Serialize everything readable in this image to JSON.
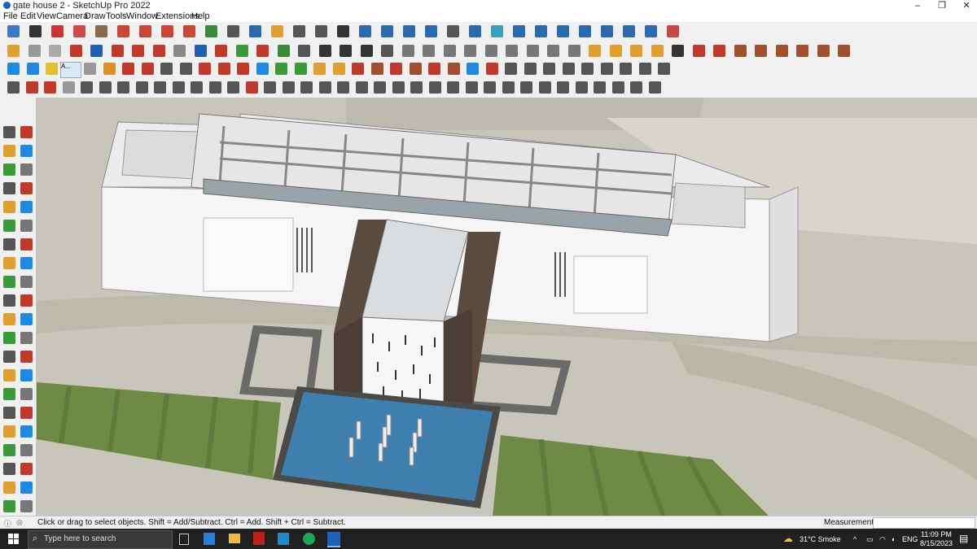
{
  "window": {
    "title": "gate house 2 - SketchUp Pro 2022",
    "minimize": "–",
    "maximize": "❐",
    "close": "✕"
  },
  "menu": [
    "File",
    "Edit",
    "View",
    "Camera",
    "Draw",
    "Tools",
    "Window",
    "Extensions",
    "Help"
  ],
  "toolbars": {
    "row1_colors": [
      "#3a78c9",
      "#333",
      "#c33",
      "#d04a4a",
      "#8a6a4a",
      "#c43",
      "#c43",
      "#c43",
      "#c43",
      "#3a8a3a",
      "#555",
      "#2a6ab0",
      "#e0a030",
      "#555",
      "#555",
      "#333",
      "#2a6ab0",
      "#2a6ab0",
      "#2a6ab0",
      "#2a6ab0",
      "#555",
      "#2a6ab0",
      "#3aa0c0",
      "#2a6ab0",
      "#2a6ab0",
      "#2a6ab0",
      "#2a6ab0",
      "#2a6ab0",
      "#2a6ab0",
      "#2a6ab0",
      "#c44"
    ],
    "row2_colors": [
      "#e0a030",
      "#999",
      "#aaa",
      "#c0392b",
      "#1e5fb0",
      "#c0392b",
      "#c0392b",
      "#c0392b",
      "#888",
      "#1e5fb0",
      "#c0392b",
      "#3a9a3a",
      "#c0392b",
      "#3a8a3a",
      "#555",
      "#333",
      "#333",
      "#333",
      "#555",
      "#777",
      "#777",
      "#777",
      "#777",
      "#777",
      "#777",
      "#777",
      "#777",
      "#777",
      "#e0a030",
      "#e0a030",
      "#e0a030",
      "#e0a030",
      "#333",
      "#c0392b",
      "#c0392b",
      "#a05030",
      "#a05030",
      "#a05030",
      "#a05030",
      "#a05030",
      "#a05030"
    ],
    "row3_colors": [
      "#1e88e5",
      "#1e88e5",
      "#e0c030",
      "#c04040",
      "#999",
      "#e09020",
      "#c0392b",
      "#c0392b",
      "#555",
      "#555",
      "#c0392b",
      "#c0392b",
      "#c0392b",
      "#1e88e5",
      "#3a9a3a",
      "#3a9a3a",
      "#e0a030",
      "#e0a030",
      "#c0392b",
      "#a05030",
      "#c0392b",
      "#a05030",
      "#c0392b",
      "#a05030",
      "#1e88e5",
      "#c0392b",
      "#555",
      "#555",
      "#555",
      "#555",
      "#555",
      "#555",
      "#555",
      "#555",
      "#555"
    ],
    "row4_colors": [
      "#555",
      "#c0392b",
      "#c0392b",
      "#999",
      "#555",
      "#555",
      "#555",
      "#555",
      "#555",
      "#555",
      "#555",
      "#555",
      "#555",
      "#c0392b",
      "#555",
      "#555",
      "#555",
      "#555",
      "#555",
      "#555",
      "#555",
      "#555",
      "#555",
      "#555",
      "#555",
      "#555",
      "#555",
      "#555",
      "#555",
      "#555",
      "#555",
      "#555",
      "#555",
      "#555",
      "#555",
      "#555"
    ],
    "tooltip_label": "A..."
  },
  "left_tools": [
    "select-icon",
    "orbit-icon",
    "paint-bucket-icon",
    "eraser-icon",
    "component-icon",
    "tag-icon",
    "line-icon",
    "freehand-icon",
    "rectangle-icon",
    "rotated-rectangle-icon",
    "circle-icon",
    "polygon-icon",
    "arc-icon",
    "pie-icon",
    "arc-3pt-icon",
    "arc-2pt-icon",
    "move-icon",
    "push-pull-icon",
    "rotate-icon",
    "follow-me-icon",
    "scale-icon",
    "offset-icon",
    "tape-measure-icon",
    "text-icon",
    "protractor-icon",
    "axes-icon",
    "dimension-icon",
    "3d-text-icon",
    "orbit-icon-2",
    "pan-icon",
    "zoom-icon",
    "zoom-window-icon",
    "zoom-extents-icon",
    "previous-view-icon",
    "position-camera-icon",
    "look-around-icon",
    "walk-icon",
    "section-plane-icon",
    "sandbox-icon",
    "smoove-icon",
    "stamp-icon",
    "drape-icon"
  ],
  "status": {
    "hint": "Click or drag to select objects. Shift = Add/Subtract. Ctrl = Add. Shift + Ctrl = Subtract.",
    "measurements_label": "Measurements",
    "measurements_value": ""
  },
  "taskbar": {
    "search_placeholder": "Type here to search",
    "weather": "31°C  Smoke",
    "language": "ENG",
    "time": "11:09 PM",
    "date": "8/15/2023"
  },
  "colors": {
    "grass": "#6f8a45",
    "water": "#3f7fb0",
    "paving": "#c6c3b6",
    "building": "#f2f2f2",
    "dark_panel": "#5a4a40"
  }
}
